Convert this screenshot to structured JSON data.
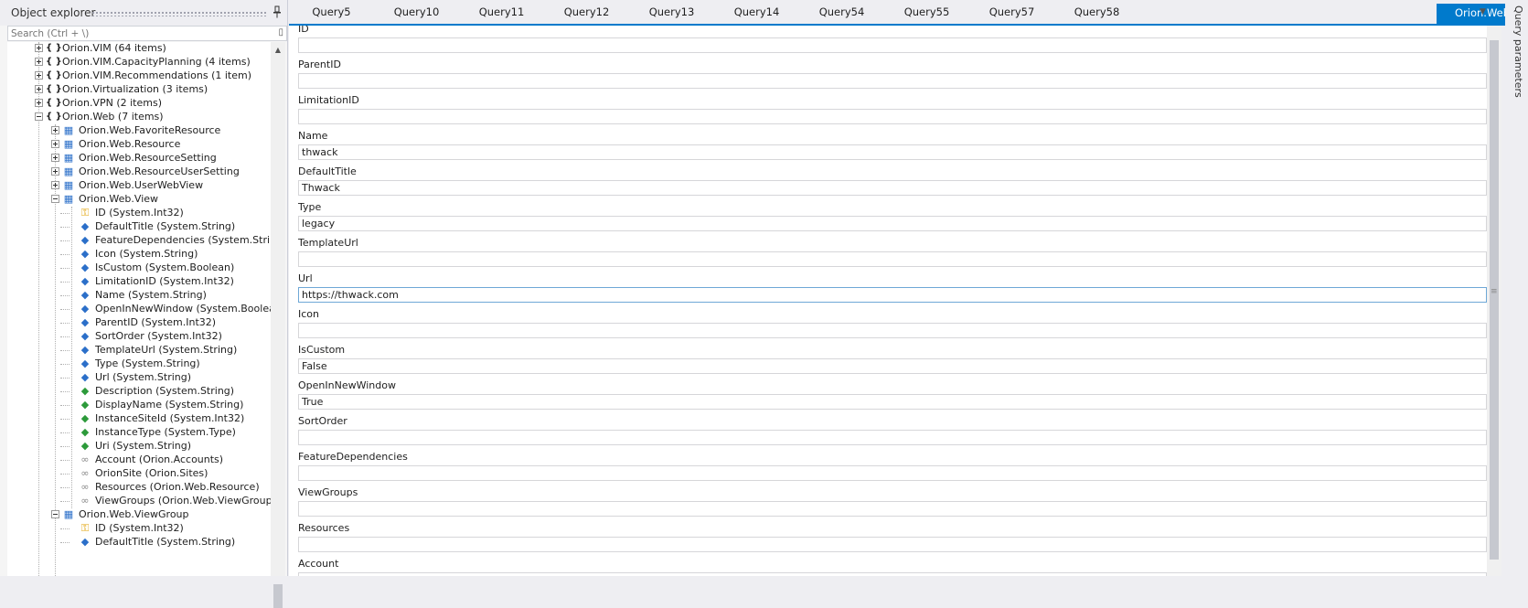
{
  "explorer": {
    "title": "Object explorer",
    "search_placeholder": "Search (Ctrl + \\)",
    "tree": [
      {
        "label": "Orion.VIM (64 items)",
        "kind": "namespace",
        "level": 0,
        "exp": "plus"
      },
      {
        "label": "Orion.VIM.CapacityPlanning (4 items)",
        "kind": "namespace",
        "level": 0,
        "exp": "plus"
      },
      {
        "label": "Orion.VIM.Recommendations (1 item)",
        "kind": "namespace",
        "level": 0,
        "exp": "plus"
      },
      {
        "label": "Orion.Virtualization (3 items)",
        "kind": "namespace",
        "level": 0,
        "exp": "plus"
      },
      {
        "label": "Orion.VPN (2 items)",
        "kind": "namespace",
        "level": 0,
        "exp": "plus"
      },
      {
        "label": "Orion.Web (7 items)",
        "kind": "namespace",
        "level": 0,
        "exp": "minus"
      },
      {
        "label": "Orion.Web.FavoriteResource",
        "kind": "entity",
        "level": 1,
        "exp": "plus"
      },
      {
        "label": "Orion.Web.Resource",
        "kind": "entity",
        "level": 1,
        "exp": "plus"
      },
      {
        "label": "Orion.Web.ResourceSetting",
        "kind": "entity",
        "level": 1,
        "exp": "plus"
      },
      {
        "label": "Orion.Web.ResourceUserSetting",
        "kind": "entity",
        "level": 1,
        "exp": "plus"
      },
      {
        "label": "Orion.Web.UserWebView",
        "kind": "entity",
        "level": 1,
        "exp": "plus"
      },
      {
        "label": "Orion.Web.View",
        "kind": "entity",
        "level": 1,
        "exp": "minus"
      },
      {
        "label": "ID (System.Int32)",
        "kind": "key",
        "level": 2
      },
      {
        "label": "DefaultTitle (System.String)",
        "kind": "prop",
        "level": 2
      },
      {
        "label": "FeatureDependencies (System.String)",
        "kind": "prop",
        "level": 2
      },
      {
        "label": "Icon (System.String)",
        "kind": "prop",
        "level": 2
      },
      {
        "label": "IsCustom (System.Boolean)",
        "kind": "prop",
        "level": 2
      },
      {
        "label": "LimitationID (System.Int32)",
        "kind": "prop",
        "level": 2
      },
      {
        "label": "Name (System.String)",
        "kind": "prop",
        "level": 2
      },
      {
        "label": "OpenInNewWindow (System.Boolean)",
        "kind": "prop",
        "level": 2
      },
      {
        "label": "ParentID (System.Int32)",
        "kind": "prop",
        "level": 2
      },
      {
        "label": "SortOrder (System.Int32)",
        "kind": "prop",
        "level": 2
      },
      {
        "label": "TemplateUrl (System.String)",
        "kind": "prop",
        "level": 2
      },
      {
        "label": "Type (System.String)",
        "kind": "prop",
        "level": 2
      },
      {
        "label": "Url (System.String)",
        "kind": "prop",
        "level": 2
      },
      {
        "label": "Description (System.String)",
        "kind": "inherited",
        "level": 2
      },
      {
        "label": "DisplayName (System.String)",
        "kind": "inherited",
        "level": 2
      },
      {
        "label": "InstanceSiteId (System.Int32)",
        "kind": "inherited",
        "level": 2
      },
      {
        "label": "InstanceType (System.Type)",
        "kind": "inherited",
        "level": 2
      },
      {
        "label": "Uri (System.String)",
        "kind": "inherited",
        "level": 2
      },
      {
        "label": "Account (Orion.Accounts)",
        "kind": "link",
        "level": 2
      },
      {
        "label": "OrionSite (Orion.Sites)",
        "kind": "link",
        "level": 2
      },
      {
        "label": "Resources (Orion.Web.Resource)",
        "kind": "link",
        "level": 2
      },
      {
        "label": "ViewGroups (Orion.Web.ViewGroup)",
        "kind": "link",
        "level": 2
      },
      {
        "label": "Orion.Web.ViewGroup",
        "kind": "entity",
        "level": 1,
        "exp": "minus"
      },
      {
        "label": "ID (System.Int32)",
        "kind": "key",
        "level": 2
      },
      {
        "label": "DefaultTitle (System.String)",
        "kind": "prop",
        "level": 2
      }
    ]
  },
  "tabs": [
    "Query5",
    "Query10",
    "Query11",
    "Query12",
    "Query13",
    "Query14",
    "Query54",
    "Query55",
    "Query57",
    "Query58"
  ],
  "active_tab": {
    "label": "Orion.Web.View - Create",
    "close": "✕"
  },
  "side_panel": {
    "label": "Query parameters"
  },
  "form": {
    "fields": [
      {
        "label": "ID",
        "value": ""
      },
      {
        "label": "ParentID",
        "value": ""
      },
      {
        "label": "LimitationID",
        "value": ""
      },
      {
        "label": "Name",
        "value": "thwack"
      },
      {
        "label": "DefaultTitle",
        "value": "Thwack"
      },
      {
        "label": "Type",
        "value": "legacy"
      },
      {
        "label": "TemplateUrl",
        "value": ""
      },
      {
        "label": "Url",
        "value": "https://thwack.com",
        "focused": true
      },
      {
        "label": "Icon",
        "value": ""
      },
      {
        "label": "IsCustom",
        "value": "False"
      },
      {
        "label": "OpenInNewWindow",
        "value": "True"
      },
      {
        "label": "SortOrder",
        "value": ""
      },
      {
        "label": "FeatureDependencies",
        "value": ""
      },
      {
        "label": "ViewGroups",
        "value": ""
      },
      {
        "label": "Resources",
        "value": ""
      },
      {
        "label": "Account",
        "value": ""
      }
    ]
  },
  "colors": {
    "accent": "#007acc",
    "key_icon": "#e0a000",
    "prop_icon": "#2b6fc9",
    "inherited_icon": "#2c9a3a",
    "link_icon": "#8a8a8a"
  }
}
